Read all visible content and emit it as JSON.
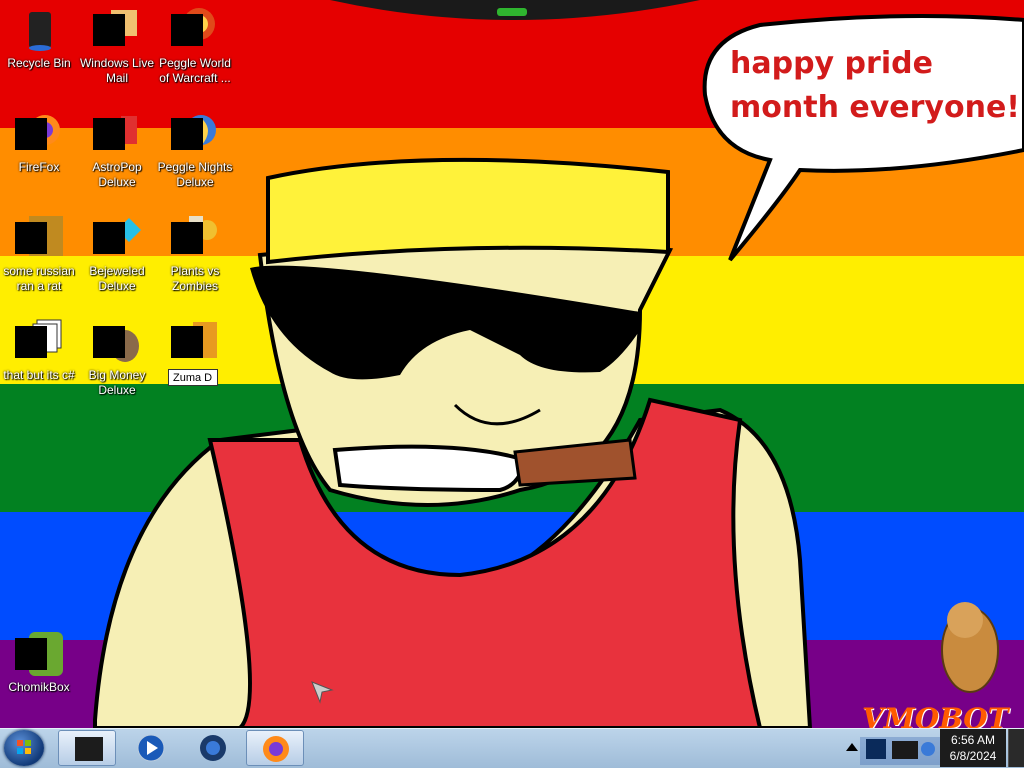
{
  "wallpaper": {
    "speech_bubble": "happy pride month everyone!",
    "flag_colors": [
      "#e50000",
      "#ff8d00",
      "#ffee00",
      "#028121",
      "#004cff",
      "#770088"
    ],
    "watermark_text": "VMOBOT"
  },
  "desktop_icons": [
    {
      "label": "Recycle Bin",
      "icon": "recycle-bin-icon"
    },
    {
      "label": "Windows Live Mail",
      "icon": "mail-icon"
    },
    {
      "label": "Peggle World of Warcraft ...",
      "icon": "peggle-icon"
    },
    {
      "label": "FireFox",
      "icon": "firefox-icon"
    },
    {
      "label": "AstroPop Deluxe",
      "icon": "astropop-icon"
    },
    {
      "label": "Peggle Nights Deluxe",
      "icon": "peggle-nights-icon"
    },
    {
      "label": "some russian ran a rat",
      "icon": "file-icon"
    },
    {
      "label": "Bejeweled Deluxe",
      "icon": "bejeweled-icon"
    },
    {
      "label": "Plants vs Zombies",
      "icon": "pvz-icon"
    },
    {
      "label": "that but its c#",
      "icon": "stacked-windows-icon"
    },
    {
      "label": "Big Money Deluxe",
      "icon": "money-bag-icon"
    },
    {
      "label": "ChomikBox",
      "icon": "chomikbox-icon"
    }
  ],
  "rename_field": {
    "value": "Zuma D"
  },
  "taskbar": {
    "items": [
      {
        "name": "start-orb",
        "icon": "windows-logo-icon"
      },
      {
        "name": "dark-window",
        "icon": "window-icon"
      },
      {
        "name": "media-player",
        "icon": "media-play-icon"
      },
      {
        "name": "globe",
        "icon": "globe-icon"
      },
      {
        "name": "firefox",
        "icon": "firefox-icon"
      }
    ],
    "clock": {
      "time": "6:56 AM",
      "date": "6/8/2024"
    }
  }
}
